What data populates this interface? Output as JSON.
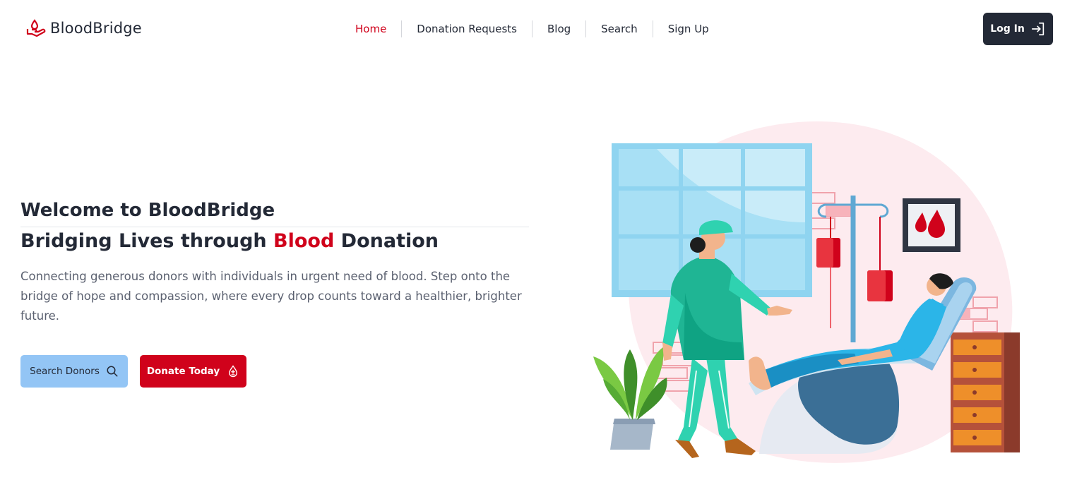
{
  "app": {
    "brand": "BloodBridge",
    "brand_color": "#d0021b",
    "dark_color": "#232936"
  },
  "nav": {
    "items": [
      {
        "label": "Home",
        "active": true
      },
      {
        "label": "Donation Requests",
        "active": false
      },
      {
        "label": "Blog",
        "active": false
      },
      {
        "label": "Search",
        "active": false
      },
      {
        "label": "Sign Up",
        "active": false
      }
    ],
    "login_label": "Log In",
    "login_icon": "log-in-icon"
  },
  "hero": {
    "title": "Welcome to BloodBridge",
    "subtitle_pre": "Bridging Lives through ",
    "subtitle_accent": "Blood",
    "subtitle_post": " Donation",
    "description": "Connecting generous donors with individuals in urgent need of blood. Step onto the bridge of hope and compassion, where every drop counts toward a healthier, brighter future.",
    "search_button": "Search Donors",
    "search_icon": "search-icon",
    "donate_button": "Donate Today",
    "donate_icon": "blood-drop-icon",
    "search_button_color": "#93c5f5"
  }
}
